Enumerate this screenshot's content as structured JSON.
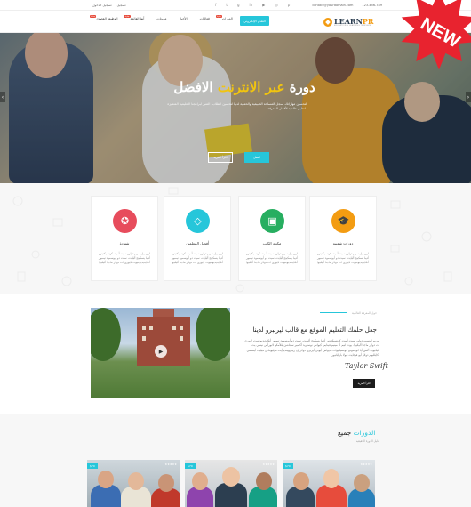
{
  "topbar": {
    "login": "تسجيل الدخول",
    "register": "تسجيل",
    "phone": "123-456-789",
    "email": "contact@yourdomain.com",
    "socials": [
      "facebook-icon",
      "twitter-icon",
      "google-plus-icon",
      "linkedin-icon",
      "youtube-icon",
      "instagram-icon",
      "pinterest-icon"
    ]
  },
  "nav": {
    "apply_button": "التقدم الإلكتروني",
    "menu": [
      {
        "label": "الدورات",
        "badge": "جديد"
      },
      {
        "label": "فعاليات",
        "badge": ""
      },
      {
        "label": "الأخبار",
        "badge": ""
      },
      {
        "label": "مدونات",
        "badge": ""
      },
      {
        "label": "أنها القائمة",
        "badge": "جديد"
      },
      {
        "label": "الوظيفة القصوى",
        "badge": "جديد"
      }
    ],
    "logo_name_a": "LEARN",
    "logo_name_b": "PR",
    "logo_tagline": "EDUCATION & LEARNING TEMPLATE"
  },
  "ribbon": {
    "label": "NEW",
    "color": "#e8232f"
  },
  "hero": {
    "title_a": "الافضل",
    "title_highlight": " عبر الانترنت ",
    "title_b": "دورة",
    "subtitle": "لتحسين مهاراتك. سجل المساحة الطبيعية والحماية لدينا لتحسين الطلاب، التميز لبرامجنا التعليمية المتميزة لتعليم عالمية لأفضل المعرفة.",
    "button_primary": "اتصل",
    "button_secondary": "اقرأ المزيد"
  },
  "features": [
    {
      "title": "دورات شعبية",
      "icon": "mortarboard-icon",
      "color": "#f39c12",
      "text": "لوريم إيبسوم دولور سيت أميت كونسيكتيتور أديبا يسكينج أليايت، سيت دو أيوسمود تيمبور أنكايديديونتيوت لابوري ات دولار ماجنا أليكيوا"
    },
    {
      "title": "مكتبة الكتب",
      "icon": "book-icon",
      "color": "#27ae60",
      "text": "لوريم إيبسوم دولور سيت أميت كونسيكتيتور أديبا يسكينج أليايت، سيت دو أيوسمود تيمبور أنكايديديونتيوت لابوري ات دولار ماجنا أليكيوا"
    },
    {
      "title": "أفضل المعلمين",
      "icon": "diamond-icon",
      "color": "#26c6da",
      "text": "لوريم إيبسوم دولور سيت أميت كونسيكتيتور أديبا يسكينج أليايت، سيت دو أيوسمود تيمبور أنكايديديونتيوت لابوري ات دولار ماجنا أليكيوا"
    },
    {
      "title": "شهادة",
      "icon": "medal-icon",
      "color": "#e74c5c",
      "text": "لوريم إيبسوم دولور سيت أميت كونسيكتيتور أديبا يسكينج أليايت، سيت دو أيوسمود تيمبور أنكايديديونتيوت لابوري ات دولار ماجنا أليكيوا"
    }
  ],
  "about": {
    "kicker": "حول المعرفة العالمية",
    "heading": "جعل حلمك التعليم الموقع مع قالب ليرنبرو لدينا",
    "paragraph": "لوريم إيبسوم دولور سيت أميت كونسيكتيتور أديبا يسكينج أليايت، سيت دو أيوسمود تيمبور أنكايديديونتيوت لابوري ات دولار ماجنا أليكيوا. يوت انيم أد مينيم فينايم، كيواس نوستريد أكسير سيتاشن يللأمكو لابورأس نيسي يت أليكيوب أكس أيا كوممودو كونسيكيوات. ديواس أيوتي أيريري دولار إن ريبريهينديرأيت فوليوبتاتي فيليت أيسسي كايلليوم دولار أيو فيجايت نيولا باراياتيور.",
    "signature": "Taylor Swift",
    "read_more": "اقرأ المزيد"
  },
  "courses": {
    "heading_a": "جميع ",
    "heading_highlight": "الدورات",
    "subheading": "دليل الدورة الحقيقية",
    "cards": [
      {
        "price": "$70",
        "rating": "★★★★★"
      },
      {
        "price": "$70",
        "rating": "★★★★★"
      },
      {
        "price": "$70",
        "rating": "★★★★★"
      }
    ]
  }
}
